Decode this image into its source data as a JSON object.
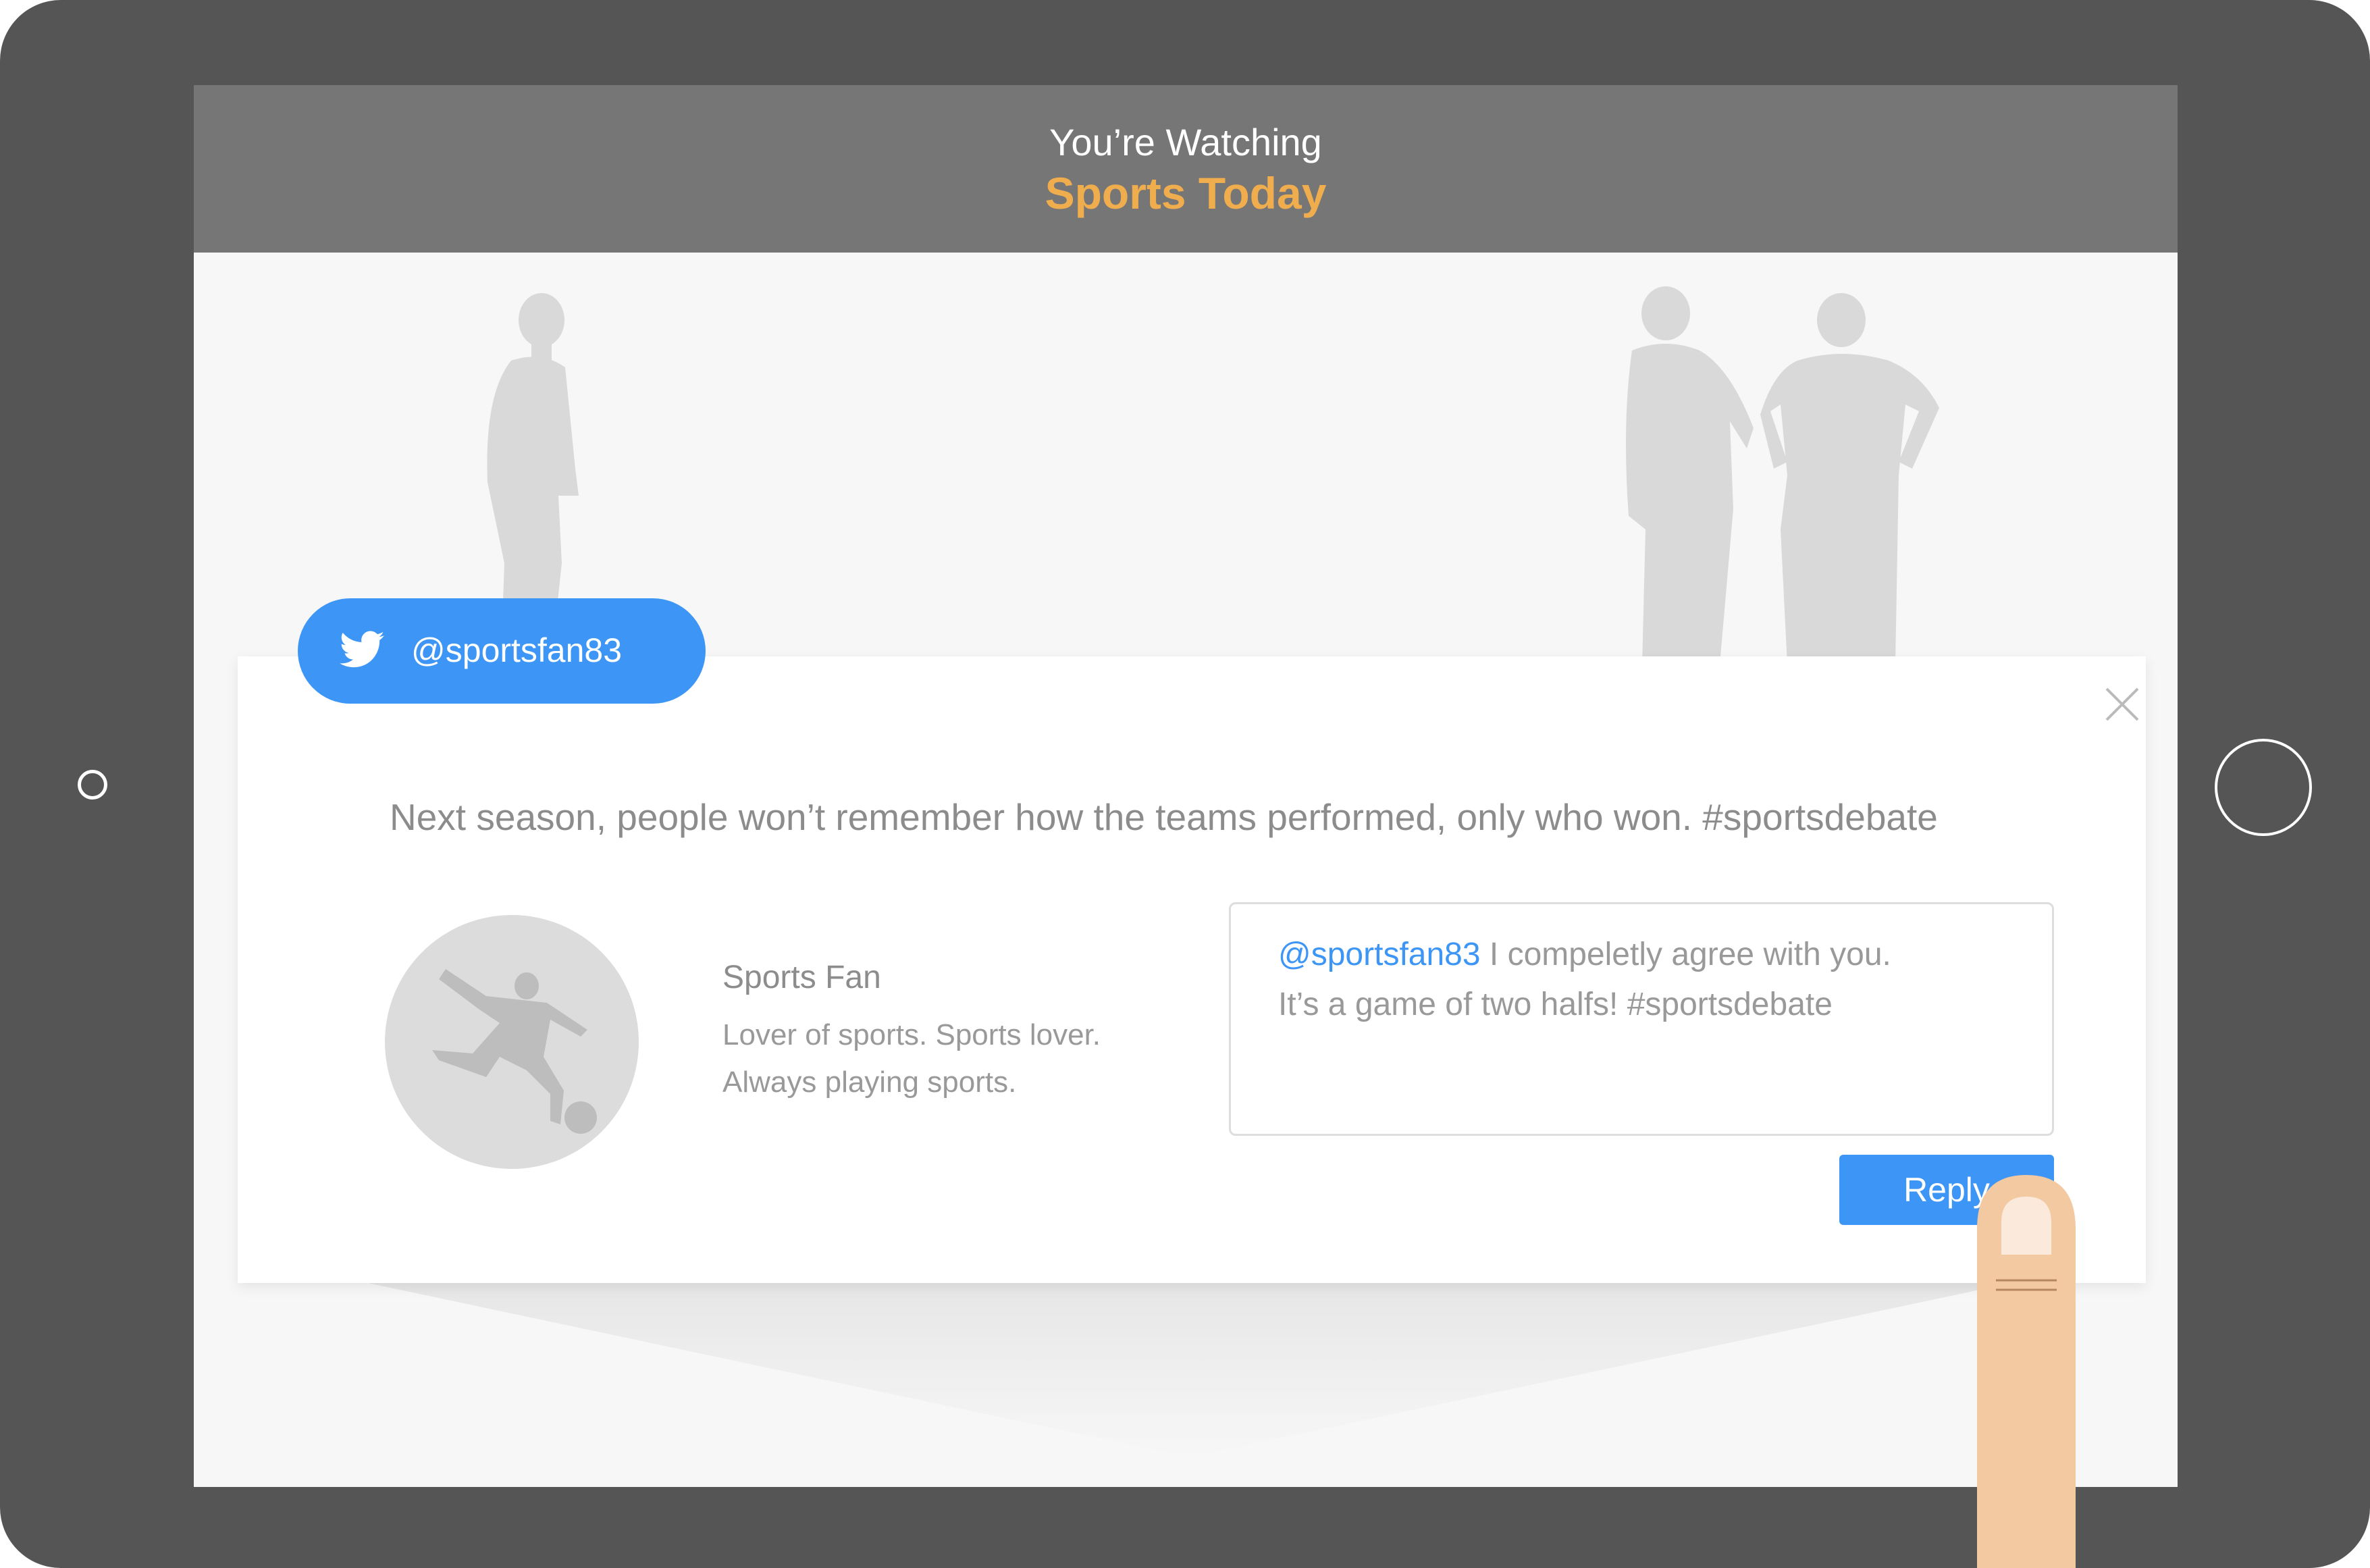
{
  "header": {
    "subtitle": "You’re Watching",
    "title": "Sports Today"
  },
  "tweet": {
    "handle": "@sportsfan83",
    "icon": "twitter-bird-icon",
    "text": "Next season, people won’t remember how the teams performed, only who won. #sportsdebate"
  },
  "profile": {
    "name": "Sports Fan",
    "bio_line1": "Lover of sports. Sports lover.",
    "bio_line2": "Always playing sports."
  },
  "reply": {
    "mention": "@sportsfan83",
    "text_line1": " I compeletly agree with you.",
    "text_line2": "It’s a game of two halfs! #sportsdebate",
    "button_label": "Reply"
  },
  "colors": {
    "accent": "#3d96f5",
    "title": "#f0ad4e",
    "bezel": "#555555",
    "header_bar": "#767676"
  }
}
